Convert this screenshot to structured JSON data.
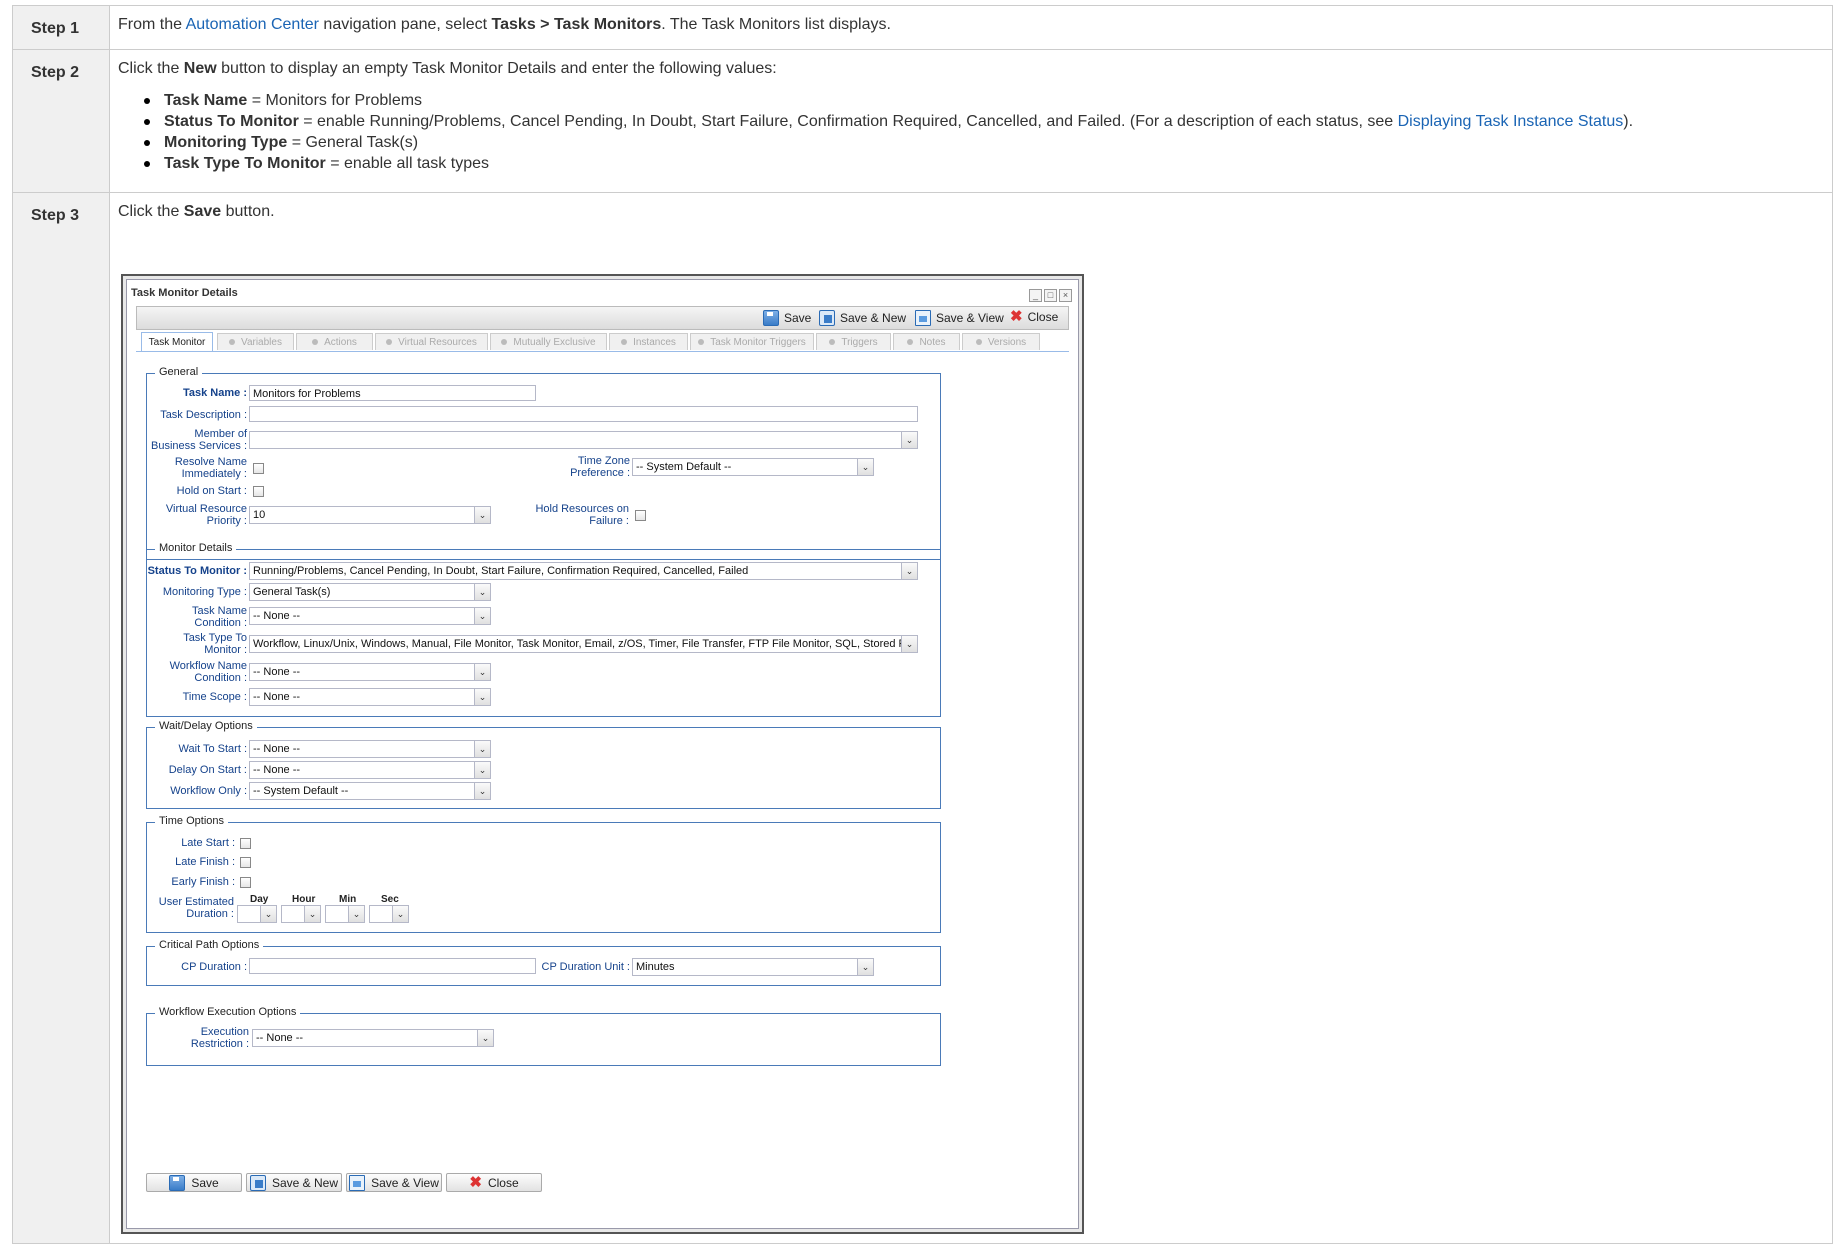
{
  "steps": [
    {
      "label": "Step 1",
      "pre": "From the ",
      "link": "Automation Center",
      "mid": " navigation pane, select ",
      "bold": "Tasks > Task Monitors",
      "post": ". The Task Monitors list displays."
    },
    {
      "label": "Step 2",
      "pre": "Click the ",
      "bold": "New",
      "post": " button to display an empty Task Monitor Details and enter the following values:",
      "bullets": [
        {
          "k": "Task Name",
          "v": " = Monitors for Problems"
        },
        {
          "k": "Status To Monitor",
          "v": " = enable Running/Problems, Cancel Pending, In Doubt, Start Failure, Confirmation Required, Cancelled, and Failed. (For a description of each status, see ",
          "link": "Displaying Task Instance Status",
          "end": ")."
        },
        {
          "k": "Monitoring Type",
          "v": " = General Task(s)"
        },
        {
          "k": "Task Type To Monitor",
          "v": " = enable all task types"
        }
      ]
    },
    {
      "label": "Step 3",
      "pre": "Click the ",
      "bold": "Save",
      "post": " button."
    }
  ],
  "dialog": {
    "title": "Task Monitor Details",
    "toolbar": {
      "save": "Save",
      "save_new": "Save & New",
      "save_view": "Save & View",
      "close": "Close"
    },
    "tabs": [
      "Task Monitor",
      "Variables",
      "Actions",
      "Virtual Resources",
      "Mutually Exclusive",
      "Instances",
      "Task Monitor Triggers",
      "Triggers",
      "Notes",
      "Versions"
    ],
    "general": {
      "legend": "General",
      "task_name_label": "Task Name :",
      "task_name": "Monitors for Problems",
      "task_desc_label": "Task Description :",
      "member_label_1": "Member of",
      "member_label_2": "Business Services :",
      "resolve_label_1": "Resolve Name",
      "resolve_label_2": "Immediately :",
      "tz_label_1": "Time Zone",
      "tz_label_2": "Preference :",
      "tz_value": "-- System Default --",
      "hold_label": "Hold on Start :",
      "vr_label_1": "Virtual Resource",
      "vr_label_2": "Priority :",
      "vr_value": "10",
      "hrf_label_1": "Hold Resources on",
      "hrf_label_2": "Failure :"
    },
    "monitor": {
      "legend": "Monitor Details",
      "status_label": "Status To Monitor :",
      "status_value": "Running/Problems, Cancel Pending, In Doubt, Start Failure, Confirmation Required, Cancelled, Failed",
      "mtype_label": "Monitoring Type :",
      "mtype_value": "General Task(s)",
      "tnc_label_1": "Task Name",
      "tnc_label_2": "Condition :",
      "tnc_value": "-- None --",
      "ttm_label_1": "Task Type To",
      "ttm_label_2": "Monitor :",
      "ttm_value": "Workflow, Linux/Unix, Windows, Manual, File Monitor, Task Monitor, Email, z/OS, Timer, File Transfer, FTP File Monitor, SQL, Stored Procedure, Uni...",
      "wnc_label_1": "Workflow Name",
      "wnc_label_2": "Condition :",
      "wnc_value": "-- None --",
      "ts_label": "Time Scope :",
      "ts_value": "-- None --"
    },
    "wait": {
      "legend": "Wait/Delay Options",
      "wts_label": "Wait To Start :",
      "wts_value": "-- None --",
      "dos_label": "Delay On Start :",
      "dos_value": "-- None --",
      "wo_label": "Workflow Only :",
      "wo_value": "-- System Default --"
    },
    "time": {
      "legend": "Time Options",
      "late_start": "Late Start :",
      "late_finish": "Late Finish :",
      "early_finish": "Early Finish :",
      "ued_label_1": "User Estimated",
      "ued_label_2": "Duration :",
      "day": "Day",
      "hour": "Hour",
      "min": "Min",
      "sec": "Sec"
    },
    "critical": {
      "legend": "Critical Path Options",
      "cpd_label": "CP Duration :",
      "cpu_label": "CP Duration Unit :",
      "cpu_value": "Minutes"
    },
    "workflow": {
      "legend": "Workflow Execution Options",
      "er_label_1": "Execution",
      "er_label_2": "Restriction :",
      "er_value": "-- None --"
    }
  }
}
